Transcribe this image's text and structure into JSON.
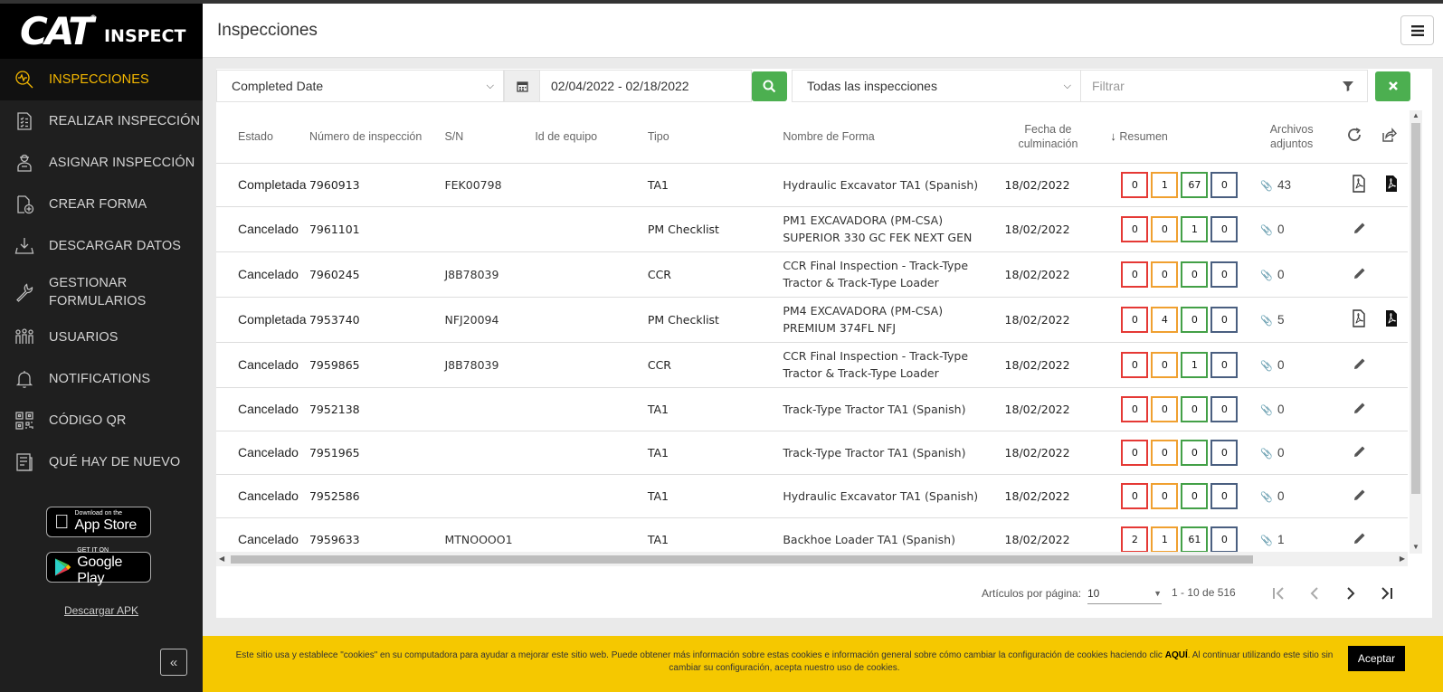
{
  "brand": {
    "logo": "CAT",
    "reg": "®",
    "product": "INSPECT"
  },
  "sidebar": {
    "items": [
      {
        "label": "INSPECCIONES",
        "icon": "inspect-search-icon"
      },
      {
        "label": "REALIZAR INSPECCIÓN",
        "icon": "checklist-icon"
      },
      {
        "label": "ASIGNAR INSPECCIÓN",
        "icon": "inspector-icon"
      },
      {
        "label": "CREAR FORMA",
        "icon": "new-form-icon"
      },
      {
        "label": "DESCARGAR DATOS",
        "icon": "download-icon"
      },
      {
        "label": "GESTIONAR FORMULARIOS",
        "icon": "wrench-icon"
      },
      {
        "label": "USUARIOS",
        "icon": "users-icon"
      },
      {
        "label": "NOTIFICATIONS",
        "icon": "bell-icon"
      },
      {
        "label": "CÓDIGO QR",
        "icon": "qr-code-icon"
      },
      {
        "label": "QUÉ HAY DE NUEVO",
        "icon": "news-icon"
      }
    ],
    "appstore_small": "Download on the",
    "appstore_big": "App Store",
    "gplay_small": "GET IT ON",
    "gplay_big": "Google Play",
    "apk_link": "Descargar APK",
    "collapse": "«"
  },
  "header": {
    "title": "Inspecciones"
  },
  "filters": {
    "date_field": "Completed Date",
    "date_range": "02/04/2022 - 02/18/2022",
    "type_filter": "Todas las inspecciones",
    "filter_placeholder": "Filtrar"
  },
  "table": {
    "headers": {
      "estado": "Estado",
      "numero": "Número de inspección",
      "sn": "S/N",
      "equipo": "Id de equipo",
      "tipo": "Tipo",
      "forma": "Nombre de Forma",
      "fecha1": "Fecha de",
      "fecha2": "culminación",
      "resumen": "Resumen",
      "arch1": "Archivos",
      "arch2": "adjuntos"
    },
    "rows": [
      {
        "estado": "Completada",
        "numero": "7960913",
        "sn": "FEK00798",
        "equipo": "",
        "tipo": "TA1",
        "forma": "Hydraulic Excavator TA1 (Spanish)",
        "fecha": "18/02/2022",
        "resumen": [
          "0",
          "1",
          "67",
          "0"
        ],
        "adjuntos": "43",
        "pdf": true
      },
      {
        "estado": "Cancelado",
        "numero": "7961101",
        "sn": "",
        "equipo": "",
        "tipo": "PM Checklist",
        "forma": "PM1 EXCAVADORA (PM-CSA) SUPERIOR 330 GC FEK NEXT GEN",
        "fecha": "18/02/2022",
        "resumen": [
          "0",
          "0",
          "1",
          "0"
        ],
        "adjuntos": "0",
        "pdf": false
      },
      {
        "estado": "Cancelado",
        "numero": "7960245",
        "sn": "J8B78039",
        "equipo": "",
        "tipo": "CCR",
        "forma": "CCR Final Inspection - Track-Type Tractor & Track-Type Loader",
        "fecha": "18/02/2022",
        "resumen": [
          "0",
          "0",
          "0",
          "0"
        ],
        "adjuntos": "0",
        "pdf": false
      },
      {
        "estado": "Completada",
        "numero": "7953740",
        "sn": "NFJ20094",
        "equipo": "",
        "tipo": "PM Checklist",
        "forma": "PM4 EXCAVADORA (PM-CSA) PREMIUM 374FL NFJ",
        "fecha": "18/02/2022",
        "resumen": [
          "0",
          "4",
          "0",
          "0"
        ],
        "adjuntos": "5",
        "pdf": true
      },
      {
        "estado": "Cancelado",
        "numero": "7959865",
        "sn": "J8B78039",
        "equipo": "",
        "tipo": "CCR",
        "forma": "CCR Final Inspection - Track-Type Tractor & Track-Type Loader",
        "fecha": "18/02/2022",
        "resumen": [
          "0",
          "0",
          "1",
          "0"
        ],
        "adjuntos": "0",
        "pdf": false
      },
      {
        "estado": "Cancelado",
        "numero": "7952138",
        "sn": "",
        "equipo": "",
        "tipo": "TA1",
        "forma": "Track-Type Tractor TA1 (Spanish)",
        "fecha": "18/02/2022",
        "resumen": [
          "0",
          "0",
          "0",
          "0"
        ],
        "adjuntos": "0",
        "pdf": false
      },
      {
        "estado": "Cancelado",
        "numero": "7951965",
        "sn": "",
        "equipo": "",
        "tipo": "TA1",
        "forma": "Track-Type Tractor TA1 (Spanish)",
        "fecha": "18/02/2022",
        "resumen": [
          "0",
          "0",
          "0",
          "0"
        ],
        "adjuntos": "0",
        "pdf": false
      },
      {
        "estado": "Cancelado",
        "numero": "7952586",
        "sn": "",
        "equipo": "",
        "tipo": "TA1",
        "forma": "Hydraulic Excavator TA1 (Spanish)",
        "fecha": "18/02/2022",
        "resumen": [
          "0",
          "0",
          "0",
          "0"
        ],
        "adjuntos": "0",
        "pdf": false
      },
      {
        "estado": "Cancelado",
        "numero": "7959633",
        "sn": "MTNOOOO1",
        "equipo": "",
        "tipo": "TA1",
        "forma": "Backhoe Loader TA1 (Spanish)",
        "fecha": "18/02/2022",
        "resumen": [
          "2",
          "1",
          "61",
          "0"
        ],
        "adjuntos": "1",
        "pdf": false
      }
    ]
  },
  "pager": {
    "per_page_label": "Artículos por página:",
    "per_page": "10",
    "range": "1 - 10 de 516"
  },
  "cookie": {
    "text_before": "Este sitio usa y establece \"cookies\" en su computadora para ayudar a mejorar este sitio web. Puede obtener más información sobre estas cookies e información general sobre cómo cambiar la configuración de cookies haciendo clic ",
    "link": "AQUÍ",
    "text_after": ". Al continuar utilizando este sitio sin cambiar su configuración, acepta nuestro uso de cookies.",
    "accept": "Aceptar"
  },
  "colors": {
    "accent": "#f5b800",
    "sidebar": "#1f1f1f",
    "green": "#4caf50",
    "cookie": "#f5c800"
  }
}
